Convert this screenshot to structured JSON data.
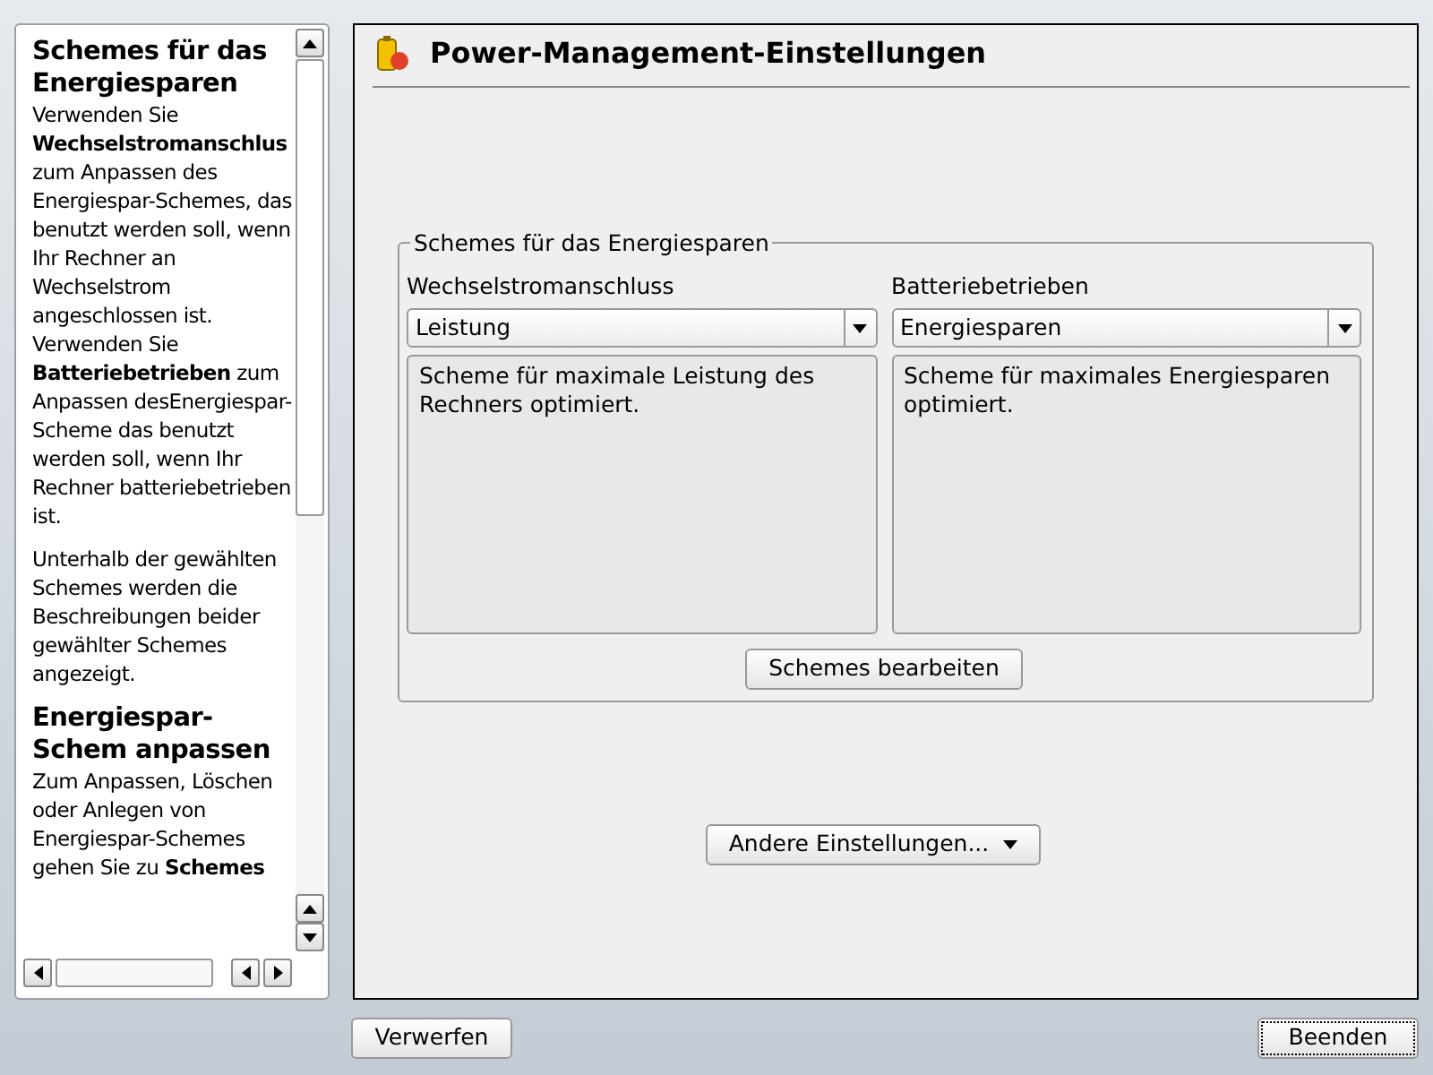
{
  "help": {
    "blocks": [
      {
        "kind": "heading",
        "text": "Schemes für das Energiesparen"
      },
      {
        "kind": "paragraph",
        "text": "Verwenden Sie **Wechselstromanschlus** zum Anpassen des Energiespar-Schemes, das benutzt werden soll, wenn Ihr Rechner an Wechselstrom angeschlossen ist. Verwenden Sie **Batteriebetrieben** zum Anpassen desEnergiespar-Scheme das benutzt werden soll, wenn Ihr Rechner batteriebetrieben ist."
      },
      {
        "kind": "paragraph",
        "text": "Unterhalb der gewählten Schemes werden die Beschreibungen beider gewählter Schemes angezeigt."
      },
      {
        "kind": "heading",
        "text": "Energiespar-Schem anpassen"
      },
      {
        "kind": "paragraph",
        "text": "Zum Anpassen, Löschen oder Anlegen von Energiespar-Schemes gehen Sie zu **Schemes**"
      }
    ]
  },
  "main": {
    "title": "Power-Management-Einstellungen",
    "group": {
      "title": "Schemes für das Energiesparen",
      "columns": [
        {
          "label": "Wechselstromanschluss",
          "value": "Leistung",
          "description": "Scheme für maximale Leistung des Rechners optimiert."
        },
        {
          "label": "Batteriebetrieben",
          "value": "Energiesparen",
          "description": "Scheme für maximales Energiesparen optimiert."
        }
      ],
      "button": "Schemes bearbeiten"
    },
    "menu_button": "Andere Einstellungen..."
  },
  "buttons": [
    {
      "label": "Verwerfen",
      "focused": false
    },
    {
      "label": "Beenden",
      "focused": true
    }
  ]
}
